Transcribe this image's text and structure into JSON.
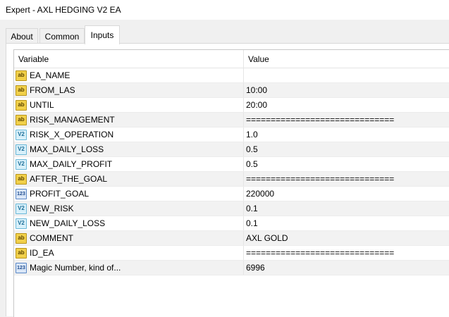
{
  "window": {
    "title": "Expert - AXL HEDGING V2 EA"
  },
  "tabs": [
    {
      "label": "About"
    },
    {
      "label": "Common"
    },
    {
      "label": "Inputs",
      "active": true
    }
  ],
  "table": {
    "columns": [
      "Variable",
      "Value"
    ],
    "rows": [
      {
        "icon": "ab",
        "variable": "EA_NAME",
        "value": ""
      },
      {
        "icon": "ab",
        "variable": "FROM_LAS",
        "value": "10:00"
      },
      {
        "icon": "ab",
        "variable": "UNTIL",
        "value": "20:00"
      },
      {
        "icon": "ab",
        "variable": "RISK_MANAGEMENT",
        "value": "=============================="
      },
      {
        "icon": "v2",
        "variable": "RISK_X_OPERATION",
        "value": "1.0"
      },
      {
        "icon": "v2",
        "variable": "MAX_DAILY_LOSS",
        "value": "0.5"
      },
      {
        "icon": "v2",
        "variable": "MAX_DAILY_PROFIT",
        "value": "0.5"
      },
      {
        "icon": "ab",
        "variable": "AFTER_THE_GOAL",
        "value": "=============================="
      },
      {
        "icon": "123",
        "variable": "PROFIT_GOAL",
        "value": "220000"
      },
      {
        "icon": "v2",
        "variable": "NEW_RISK",
        "value": "0.1"
      },
      {
        "icon": "v2",
        "variable": "NEW_DAILY_LOSS",
        "value": "0.1"
      },
      {
        "icon": "ab",
        "variable": "COMMENT",
        "value": "AXL GOLD"
      },
      {
        "icon": "ab",
        "variable": "ID_EA",
        "value": "=============================="
      },
      {
        "icon": "123",
        "variable": "Magic Number, kind of...",
        "value": "6996"
      }
    ]
  },
  "icons": {
    "ab": {
      "name": "string-type-icon",
      "glyph": "ab"
    },
    "v2": {
      "name": "double-type-icon",
      "glyph": "V2"
    },
    "123": {
      "name": "integer-type-icon",
      "glyph": "123"
    }
  }
}
